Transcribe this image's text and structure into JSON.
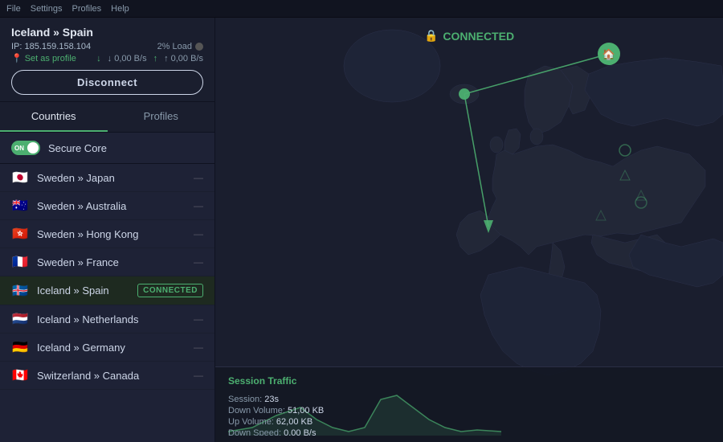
{
  "topbar": {
    "menu_items": [
      "File",
      "Settings",
      "Profiles",
      "Help"
    ]
  },
  "connection": {
    "server": "Iceland » Spain",
    "ip_label": "IP:",
    "ip_address": "185.159.158.104",
    "load_label": "2% Load",
    "set_profile": "Set as profile",
    "download": "↓ 0,00 B/s",
    "upload": "↑ 0,00 B/s",
    "disconnect_label": "Disconnect"
  },
  "tabs": {
    "countries_label": "Countries",
    "profiles_label": "Profiles"
  },
  "secure_core": {
    "label": "Secure Core",
    "on_label": "ON"
  },
  "countries": [
    {
      "flag": "🇯🇵",
      "name": "Sweden » Japan",
      "connected": false
    },
    {
      "flag": "🇦🇺",
      "name": "Sweden » Australia",
      "connected": false
    },
    {
      "flag": "🇭🇰",
      "name": "Sweden » Hong Kong",
      "connected": false
    },
    {
      "flag": "🇫🇷",
      "name": "Sweden » France",
      "connected": false
    },
    {
      "flag": "🇮🇸",
      "name": "Iceland » Spain",
      "connected": true
    },
    {
      "flag": "🇳🇱",
      "name": "Iceland » Netherlands",
      "connected": false
    },
    {
      "flag": "🇩🇪",
      "name": "Iceland » Germany",
      "connected": false
    },
    {
      "flag": "🇨🇦",
      "name": "Switzerland » Canada",
      "connected": false
    }
  ],
  "connected_label": "CONNECTED",
  "session_traffic": {
    "title": "Session Traffic",
    "rows": [
      {
        "label": "Session:",
        "value": "23",
        "unit": "s"
      },
      {
        "label": "Down Volume:",
        "value": "51,00",
        "unit": "KB"
      },
      {
        "label": "Up Volume:",
        "value": "62,00",
        "unit": "KB"
      },
      {
        "label": "Down Speed:",
        "value": "0,00",
        "unit": "B/s"
      }
    ]
  },
  "colors": {
    "accent": "#4caf70",
    "bg_dark": "#1a1e2e",
    "panel_bg": "#1e2236",
    "text_primary": "#e0e6f0",
    "text_secondary": "#8899aa"
  }
}
